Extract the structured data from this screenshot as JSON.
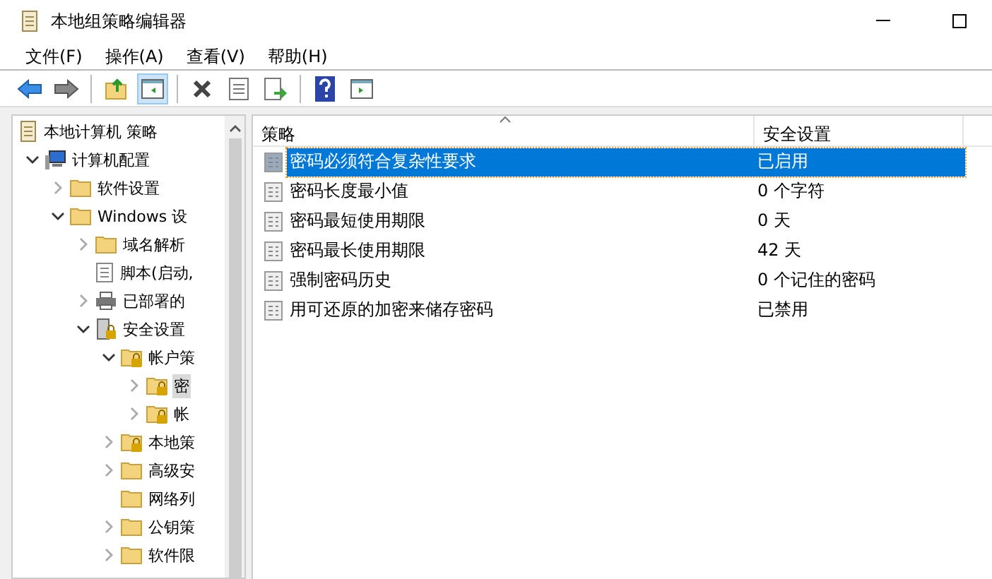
{
  "window": {
    "title": "本地组策略编辑器"
  },
  "menu": [
    "文件(F)",
    "操作(A)",
    "查看(V)",
    "帮助(H)"
  ],
  "toolbar": [
    {
      "kind": "back"
    },
    {
      "kind": "forward"
    },
    {
      "kind": "sep"
    },
    {
      "kind": "up"
    },
    {
      "kind": "panel",
      "selected": true
    },
    {
      "kind": "sep"
    },
    {
      "kind": "delete"
    },
    {
      "kind": "props"
    },
    {
      "kind": "export"
    },
    {
      "kind": "sep"
    },
    {
      "kind": "help"
    },
    {
      "kind": "panel2"
    }
  ],
  "tree": [
    {
      "label": "本地计算机 策略",
      "kind": "doc",
      "selected": false,
      "children": [
        {
          "label": "计算机配置",
          "kind": "computer",
          "expanded": true,
          "selected": false,
          "children": [
            {
              "label": "软件设置",
              "kind": "folder",
              "expanded": false,
              "selected": false
            },
            {
              "label": "Windows 设",
              "kind": "folder",
              "expanded": true,
              "selected": false,
              "children": [
                {
                  "label": "域名解析",
                  "kind": "folder",
                  "expanded": false,
                  "selected": false
                },
                {
                  "label": "脚本(启动,",
                  "kind": "script",
                  "selected": false
                },
                {
                  "label": "已部署的",
                  "kind": "printer",
                  "expanded": false,
                  "selected": false
                },
                {
                  "label": "安全设置",
                  "kind": "security",
                  "expanded": true,
                  "selected": false,
                  "children": [
                    {
                      "label": "帐户策",
                      "kind": "lockfolder",
                      "expanded": true,
                      "selected": false,
                      "children": [
                        {
                          "label": "密",
                          "kind": "lockfolder",
                          "expanded": false,
                          "selected": true
                        },
                        {
                          "label": "帐",
                          "kind": "lockfolder",
                          "expanded": false,
                          "selected": false
                        }
                      ]
                    },
                    {
                      "label": "本地策",
                      "kind": "lockfolder",
                      "expanded": false,
                      "selected": false
                    },
                    {
                      "label": "高级安",
                      "kind": "folder",
                      "expanded": false,
                      "selected": false
                    },
                    {
                      "label": "网络列",
                      "kind": "folder",
                      "selected": false
                    },
                    {
                      "label": "公钥策",
                      "kind": "folder",
                      "expanded": false,
                      "selected": false
                    },
                    {
                      "label": "软件限",
                      "kind": "folder",
                      "expanded": false,
                      "selected": false
                    }
                  ]
                }
              ]
            }
          ]
        }
      ]
    }
  ],
  "table": {
    "columns": [
      "策略",
      "安全设置"
    ],
    "rows": [
      {
        "policy": "密码必须符合复杂性要求",
        "setting": "已启用",
        "selected": true
      },
      {
        "policy": "密码长度最小值",
        "setting": "0 个字符",
        "selected": false
      },
      {
        "policy": "密码最短使用期限",
        "setting": "0 天",
        "selected": false
      },
      {
        "policy": "密码最长使用期限",
        "setting": "42 天",
        "selected": false
      },
      {
        "policy": "强制密码历史",
        "setting": "0 个记住的密码",
        "selected": false
      },
      {
        "policy": "用可还原的加密来储存密码",
        "setting": "已禁用",
        "selected": false
      }
    ]
  }
}
